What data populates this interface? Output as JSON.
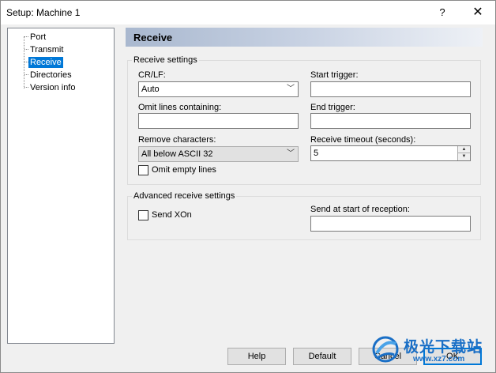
{
  "window": {
    "title": "Setup: Machine 1",
    "help_glyph": "?",
    "close_glyph": "✕"
  },
  "tree": {
    "items": [
      {
        "label": "Port",
        "selected": false
      },
      {
        "label": "Transmit",
        "selected": false
      },
      {
        "label": "Receive",
        "selected": true
      },
      {
        "label": "Directories",
        "selected": false
      },
      {
        "label": "Version info",
        "selected": false
      }
    ]
  },
  "panel": {
    "title": "Receive"
  },
  "receive_settings": {
    "group_title": "Receive settings",
    "crlf_label": "CR/LF:",
    "crlf_value": "Auto",
    "start_trigger_label": "Start trigger:",
    "start_trigger_value": "",
    "omit_lines_label": "Omit lines containing:",
    "omit_lines_value": "",
    "end_trigger_label": "End trigger:",
    "end_trigger_value": "",
    "remove_chars_label": "Remove characters:",
    "remove_chars_value": "All below ASCII 32",
    "timeout_label": "Receive timeout (seconds):",
    "timeout_value": "5",
    "omit_empty_label": "Omit empty lines",
    "omit_empty_checked": false
  },
  "advanced_settings": {
    "group_title": "Advanced receive settings",
    "send_xon_label": "Send XOn",
    "send_xon_checked": false,
    "send_at_start_label": "Send at start of reception:",
    "send_at_start_value": ""
  },
  "buttons": {
    "help": "Help",
    "default": "Default",
    "cancel": "Cancel",
    "ok": "OK"
  },
  "watermark": {
    "text_main": "极光下载站",
    "text_url": "www.xz7.com"
  },
  "colors": {
    "selection": "#0078d7",
    "header_gradient_start": "#a9b8cf",
    "header_gradient_end": "#eef1f6",
    "watermark_blue": "#1a6fc6"
  }
}
